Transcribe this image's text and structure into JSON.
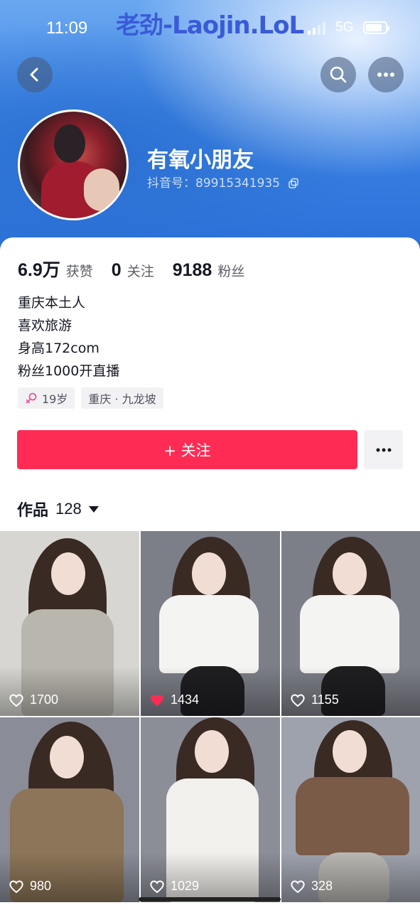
{
  "status_bar": {
    "time": "11:09",
    "watermark": "老劲-Laojin.LoL",
    "network": "5G"
  },
  "profile": {
    "nickname": "有氧小朋友",
    "douyin_id": "抖音号：89915341935"
  },
  "stats": [
    {
      "value": "6.9万",
      "label": "获赞"
    },
    {
      "value": "0",
      "label": "关注"
    },
    {
      "value": "9188",
      "label": "粉丝"
    }
  ],
  "bio": [
    "重庆本土人",
    "喜欢旅游",
    "身高172com",
    "粉丝1000开直播"
  ],
  "tags": {
    "age": "19岁",
    "location": "重庆 · 九龙坡"
  },
  "follow_button": "+ 关注",
  "works_tab": {
    "label": "作品",
    "count": "128"
  },
  "videos": [
    {
      "likes": "1700",
      "liked": false,
      "bg": "#d7d6d2",
      "outfit": "#b9b6ae"
    },
    {
      "likes": "1434",
      "liked": true,
      "bg": "#7d7f88",
      "outfit": "#f4f4f2"
    },
    {
      "likes": "1155",
      "liked": false,
      "bg": "#7d7f88",
      "outfit": "#f4f4f2"
    },
    {
      "likes": "980",
      "liked": false,
      "bg": "#8a8d98",
      "outfit": "#8c7558"
    },
    {
      "likes": "1029",
      "liked": false,
      "bg": "#8b8d97",
      "outfit": "#f2f0ec"
    },
    {
      "likes": "328",
      "liked": false,
      "bg": "#9ea2ad",
      "outfit": "#7a5b48"
    }
  ],
  "colors": {
    "accent": "#fe2c55",
    "header": "#3f86e6"
  }
}
